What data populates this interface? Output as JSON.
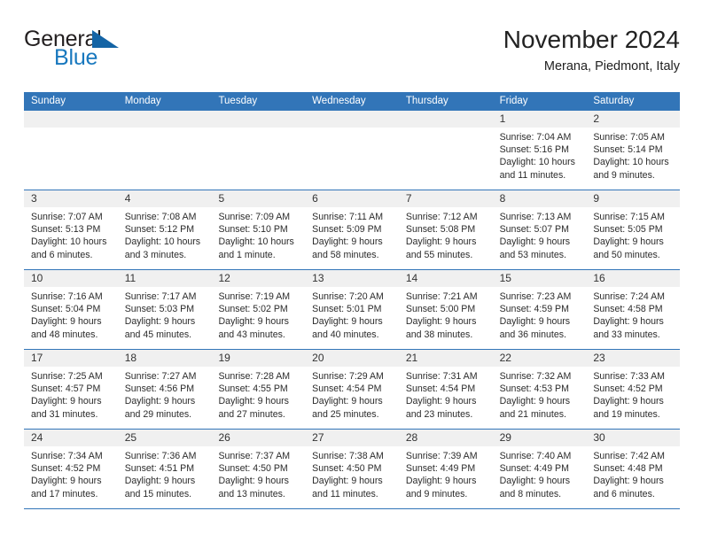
{
  "brand": {
    "name_part1": "General",
    "name_part2": "Blue",
    "triangle_icon": "triangle-icon",
    "color_dark": "#231f20",
    "color_blue": "#1878be"
  },
  "header": {
    "title": "November 2024",
    "subtitle": "Merana, Piedmont, Italy"
  },
  "calendar": {
    "header_bg": "#3275b8",
    "daynum_bg": "#f0f0f0",
    "weekdays": [
      "Sunday",
      "Monday",
      "Tuesday",
      "Wednesday",
      "Thursday",
      "Friday",
      "Saturday"
    ],
    "weeks": [
      [
        {
          "day": "",
          "lines": []
        },
        {
          "day": "",
          "lines": []
        },
        {
          "day": "",
          "lines": []
        },
        {
          "day": "",
          "lines": []
        },
        {
          "day": "",
          "lines": []
        },
        {
          "day": "1",
          "lines": [
            "Sunrise: 7:04 AM",
            "Sunset: 5:16 PM",
            "Daylight: 10 hours",
            "and 11 minutes."
          ]
        },
        {
          "day": "2",
          "lines": [
            "Sunrise: 7:05 AM",
            "Sunset: 5:14 PM",
            "Daylight: 10 hours",
            "and 9 minutes."
          ]
        }
      ],
      [
        {
          "day": "3",
          "lines": [
            "Sunrise: 7:07 AM",
            "Sunset: 5:13 PM",
            "Daylight: 10 hours",
            "and 6 minutes."
          ]
        },
        {
          "day": "4",
          "lines": [
            "Sunrise: 7:08 AM",
            "Sunset: 5:12 PM",
            "Daylight: 10 hours",
            "and 3 minutes."
          ]
        },
        {
          "day": "5",
          "lines": [
            "Sunrise: 7:09 AM",
            "Sunset: 5:10 PM",
            "Daylight: 10 hours",
            "and 1 minute."
          ]
        },
        {
          "day": "6",
          "lines": [
            "Sunrise: 7:11 AM",
            "Sunset: 5:09 PM",
            "Daylight: 9 hours",
            "and 58 minutes."
          ]
        },
        {
          "day": "7",
          "lines": [
            "Sunrise: 7:12 AM",
            "Sunset: 5:08 PM",
            "Daylight: 9 hours",
            "and 55 minutes."
          ]
        },
        {
          "day": "8",
          "lines": [
            "Sunrise: 7:13 AM",
            "Sunset: 5:07 PM",
            "Daylight: 9 hours",
            "and 53 minutes."
          ]
        },
        {
          "day": "9",
          "lines": [
            "Sunrise: 7:15 AM",
            "Sunset: 5:05 PM",
            "Daylight: 9 hours",
            "and 50 minutes."
          ]
        }
      ],
      [
        {
          "day": "10",
          "lines": [
            "Sunrise: 7:16 AM",
            "Sunset: 5:04 PM",
            "Daylight: 9 hours",
            "and 48 minutes."
          ]
        },
        {
          "day": "11",
          "lines": [
            "Sunrise: 7:17 AM",
            "Sunset: 5:03 PM",
            "Daylight: 9 hours",
            "and 45 minutes."
          ]
        },
        {
          "day": "12",
          "lines": [
            "Sunrise: 7:19 AM",
            "Sunset: 5:02 PM",
            "Daylight: 9 hours",
            "and 43 minutes."
          ]
        },
        {
          "day": "13",
          "lines": [
            "Sunrise: 7:20 AM",
            "Sunset: 5:01 PM",
            "Daylight: 9 hours",
            "and 40 minutes."
          ]
        },
        {
          "day": "14",
          "lines": [
            "Sunrise: 7:21 AM",
            "Sunset: 5:00 PM",
            "Daylight: 9 hours",
            "and 38 minutes."
          ]
        },
        {
          "day": "15",
          "lines": [
            "Sunrise: 7:23 AM",
            "Sunset: 4:59 PM",
            "Daylight: 9 hours",
            "and 36 minutes."
          ]
        },
        {
          "day": "16",
          "lines": [
            "Sunrise: 7:24 AM",
            "Sunset: 4:58 PM",
            "Daylight: 9 hours",
            "and 33 minutes."
          ]
        }
      ],
      [
        {
          "day": "17",
          "lines": [
            "Sunrise: 7:25 AM",
            "Sunset: 4:57 PM",
            "Daylight: 9 hours",
            "and 31 minutes."
          ]
        },
        {
          "day": "18",
          "lines": [
            "Sunrise: 7:27 AM",
            "Sunset: 4:56 PM",
            "Daylight: 9 hours",
            "and 29 minutes."
          ]
        },
        {
          "day": "19",
          "lines": [
            "Sunrise: 7:28 AM",
            "Sunset: 4:55 PM",
            "Daylight: 9 hours",
            "and 27 minutes."
          ]
        },
        {
          "day": "20",
          "lines": [
            "Sunrise: 7:29 AM",
            "Sunset: 4:54 PM",
            "Daylight: 9 hours",
            "and 25 minutes."
          ]
        },
        {
          "day": "21",
          "lines": [
            "Sunrise: 7:31 AM",
            "Sunset: 4:54 PM",
            "Daylight: 9 hours",
            "and 23 minutes."
          ]
        },
        {
          "day": "22",
          "lines": [
            "Sunrise: 7:32 AM",
            "Sunset: 4:53 PM",
            "Daylight: 9 hours",
            "and 21 minutes."
          ]
        },
        {
          "day": "23",
          "lines": [
            "Sunrise: 7:33 AM",
            "Sunset: 4:52 PM",
            "Daylight: 9 hours",
            "and 19 minutes."
          ]
        }
      ],
      [
        {
          "day": "24",
          "lines": [
            "Sunrise: 7:34 AM",
            "Sunset: 4:52 PM",
            "Daylight: 9 hours",
            "and 17 minutes."
          ]
        },
        {
          "day": "25",
          "lines": [
            "Sunrise: 7:36 AM",
            "Sunset: 4:51 PM",
            "Daylight: 9 hours",
            "and 15 minutes."
          ]
        },
        {
          "day": "26",
          "lines": [
            "Sunrise: 7:37 AM",
            "Sunset: 4:50 PM",
            "Daylight: 9 hours",
            "and 13 minutes."
          ]
        },
        {
          "day": "27",
          "lines": [
            "Sunrise: 7:38 AM",
            "Sunset: 4:50 PM",
            "Daylight: 9 hours",
            "and 11 minutes."
          ]
        },
        {
          "day": "28",
          "lines": [
            "Sunrise: 7:39 AM",
            "Sunset: 4:49 PM",
            "Daylight: 9 hours",
            "and 9 minutes."
          ]
        },
        {
          "day": "29",
          "lines": [
            "Sunrise: 7:40 AM",
            "Sunset: 4:49 PM",
            "Daylight: 9 hours",
            "and 8 minutes."
          ]
        },
        {
          "day": "30",
          "lines": [
            "Sunrise: 7:42 AM",
            "Sunset: 4:48 PM",
            "Daylight: 9 hours",
            "and 6 minutes."
          ]
        }
      ]
    ]
  }
}
